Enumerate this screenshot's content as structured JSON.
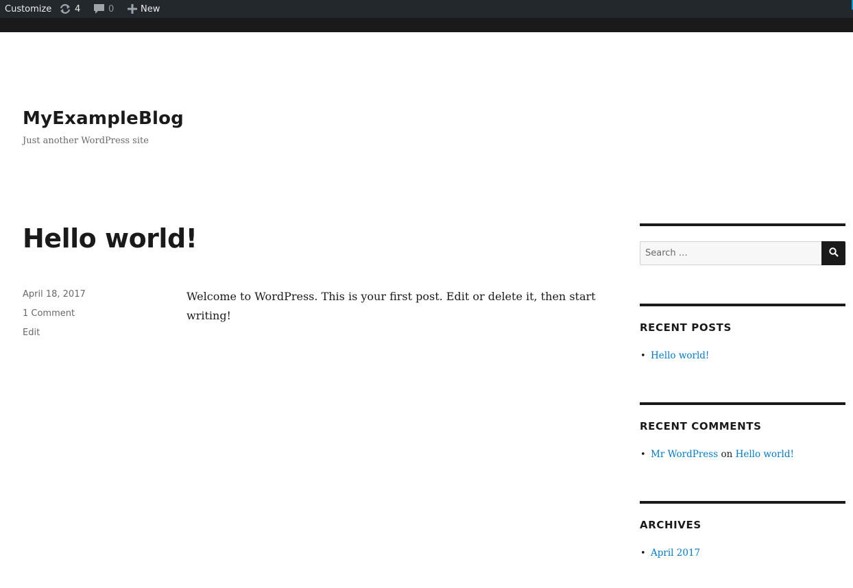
{
  "adminbar": {
    "customize_label": "Customize",
    "updates_count": "4",
    "comments_count": "0",
    "new_label": "New"
  },
  "site": {
    "title": "MyExampleBlog",
    "description": "Just another WordPress site"
  },
  "post": {
    "title": "Hello world!",
    "date": "April 18, 2017",
    "comments": "1 Comment",
    "edit": "Edit",
    "content": "Welcome to WordPress. This is your first post. Edit or delete it, then start writing!"
  },
  "sidebar": {
    "search_placeholder": "Search …",
    "recent_posts": {
      "title": "RECENT POSTS",
      "items": [
        "Hello world!"
      ]
    },
    "recent_comments": {
      "title": "RECENT COMMENTS",
      "items": [
        {
          "author": "Mr WordPress",
          "connector": "on",
          "post": "Hello world!"
        }
      ]
    },
    "archives": {
      "title": "ARCHIVES",
      "items": [
        "April 2017"
      ]
    }
  },
  "colors": {
    "adminbar_bg": "#23282d",
    "text": "#1a1a1a",
    "muted": "#686868",
    "link": "#007acc"
  },
  "icons": [
    "updates-icon",
    "comments-icon",
    "plus-icon",
    "search-icon"
  ]
}
